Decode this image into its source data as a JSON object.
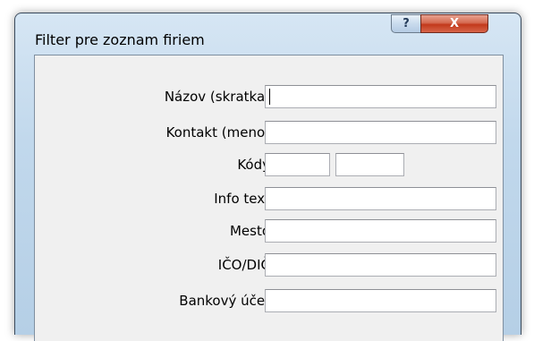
{
  "window": {
    "title": "Filter pre zoznam firiem",
    "help_label": "?",
    "close_label": "X"
  },
  "form": {
    "fields": [
      {
        "label": "Názov (skratka)",
        "value": ""
      },
      {
        "label": "Kontakt (meno)",
        "value": ""
      },
      {
        "label": "Kódy",
        "value_1": "",
        "value_2": ""
      },
      {
        "label": "Info text",
        "value": ""
      },
      {
        "label": "Mesto",
        "value": ""
      },
      {
        "label": "IČO/DIČ",
        "value": ""
      },
      {
        "label": "Bankový účet",
        "value": ""
      }
    ]
  },
  "colors": {
    "frame": "#c1d8ec",
    "client": "#f0f0f0",
    "close_button": "#c2391b"
  }
}
